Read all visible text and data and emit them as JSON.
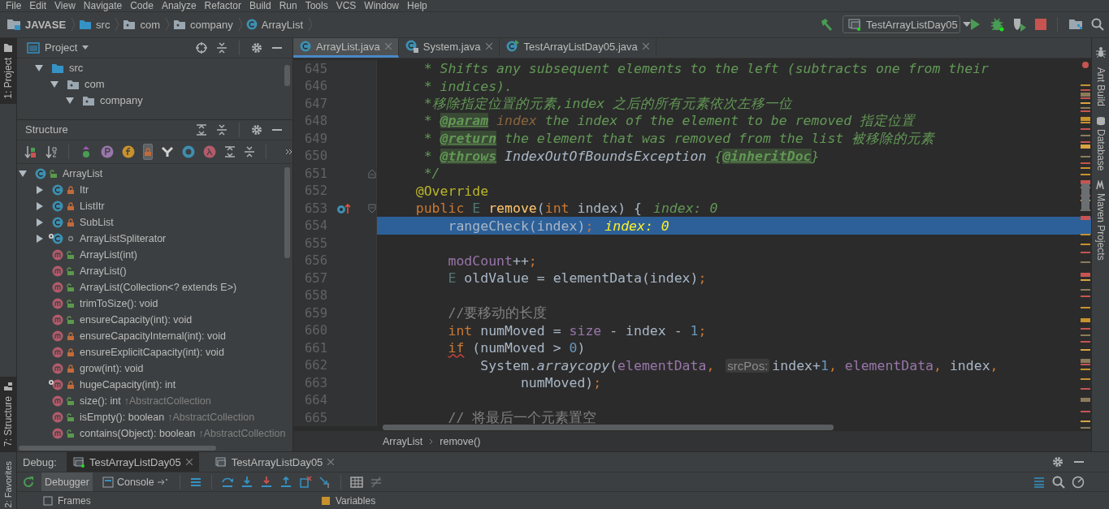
{
  "menu": [
    "File",
    "Edit",
    "View",
    "Navigate",
    "Code",
    "Analyze",
    "Refactor",
    "Build",
    "Run",
    "Tools",
    "VCS",
    "Window",
    "Help"
  ],
  "breadcrumb": [
    {
      "kind": "project",
      "label": "JAVASE"
    },
    {
      "kind": "folder",
      "label": "src"
    },
    {
      "kind": "package",
      "label": "com"
    },
    {
      "kind": "package",
      "label": "company"
    },
    {
      "kind": "class",
      "label": "ArrayList"
    }
  ],
  "run_config": {
    "label": "TestArrayListDay05"
  },
  "left_tool_tabs": [
    {
      "label": "1: Project",
      "selected": true
    },
    {
      "label": "7: Structure",
      "selected": true
    }
  ],
  "favorites_tab": {
    "label": "2: Favorites"
  },
  "project_panel": {
    "title": "Project",
    "tree": [
      {
        "label": "src",
        "kind": "folder",
        "expanded": true,
        "children": [
          {
            "label": "com",
            "kind": "package",
            "expanded": true,
            "children": [
              {
                "label": "company",
                "kind": "package",
                "expanded": true
              }
            ]
          }
        ]
      }
    ]
  },
  "structure_panel": {
    "title": "Structure",
    "tree": [
      {
        "label": "ArrayList",
        "kind": "public-class",
        "static": false,
        "expanded": true,
        "children": [
          {
            "label": "Itr",
            "kind": "private-class",
            "static": false,
            "expanded": false
          },
          {
            "label": "ListItr",
            "kind": "private-class",
            "static": false,
            "expanded": false
          },
          {
            "label": "SubList",
            "kind": "private-class",
            "static": false,
            "expanded": false
          },
          {
            "label": "ArrayListSpliterator",
            "kind": "package-class",
            "static": true,
            "expanded": false
          },
          {
            "label": "ArrayList(int)",
            "kind": "public-method",
            "static": false
          },
          {
            "label": "ArrayList()",
            "kind": "public-method",
            "static": false
          },
          {
            "label": "ArrayList(Collection<? extends E>)",
            "kind": "public-method",
            "static": false
          },
          {
            "label": "trimToSize(): void",
            "kind": "public-method",
            "static": false
          },
          {
            "label": "ensureCapacity(int): void",
            "kind": "public-method",
            "static": false
          },
          {
            "label": "ensureCapacityInternal(int): void",
            "kind": "private-method",
            "static": false
          },
          {
            "label": "ensureExplicitCapacity(int): void",
            "kind": "private-method",
            "static": false
          },
          {
            "label": "grow(int): void",
            "kind": "private-method",
            "static": false
          },
          {
            "label": "hugeCapacity(int): int",
            "kind": "private-method",
            "static": true
          },
          {
            "label": "size(): int",
            "inherited": "↑AbstractCollection",
            "kind": "public-method",
            "static": false
          },
          {
            "label": "isEmpty(): boolean",
            "inherited": "↑AbstractCollection",
            "kind": "public-method",
            "static": false
          },
          {
            "label": "contains(Object): boolean",
            "inherited": "↑AbstractCollection",
            "kind": "public-method",
            "static": false
          }
        ]
      }
    ]
  },
  "editor": {
    "tabs": [
      {
        "label": "ArrayList.java",
        "kind": "class",
        "selected": true
      },
      {
        "label": "System.java",
        "kind": "library-class",
        "selected": false
      },
      {
        "label": "TestArrayListDay05.java",
        "kind": "runnable-class",
        "selected": false
      }
    ],
    "lines": [
      {
        "number": "645",
        "current": false,
        "tokens": [
          {
            "kind": "doc",
            "text": "     * Shifts any subsequent elements to the left (subtracts one from their"
          }
        ]
      },
      {
        "number": "646",
        "current": false,
        "tokens": [
          {
            "kind": "doc",
            "text": "     * indices)."
          }
        ]
      },
      {
        "number": "647",
        "current": false,
        "tokens": [
          {
            "kind": "doc",
            "text": "     *移除指定位置的元素,index 之后的所有元素依次左移一位"
          }
        ]
      },
      {
        "number": "648",
        "current": false,
        "tokens": [
          {
            "kind": "doc",
            "text": "     * "
          },
          {
            "kind": "doctag",
            "text": "@param"
          },
          {
            "kind": "docparam",
            "text": " index"
          },
          {
            "kind": "doc",
            "text": " the index of the element to be removed 指定位置"
          }
        ]
      },
      {
        "number": "649",
        "current": false,
        "tokens": [
          {
            "kind": "doc",
            "text": "     * "
          },
          {
            "kind": "doctag",
            "text": "@return"
          },
          {
            "kind": "doc",
            "text": " the element that was removed from the list 被移除的元素"
          }
        ]
      },
      {
        "number": "650",
        "current": false,
        "tokens": [
          {
            "kind": "doc",
            "text": "     * "
          },
          {
            "kind": "doctag",
            "text": "@throws"
          },
          {
            "kind": "docref",
            "text": " IndexOutOfBoundsException "
          },
          {
            "kind": "doc",
            "text": "{"
          },
          {
            "kind": "doctag",
            "text": "@inheritDoc"
          },
          {
            "kind": "doc",
            "text": "}"
          }
        ]
      },
      {
        "number": "651",
        "current": false,
        "kind": "fold-end",
        "tokens": [
          {
            "kind": "doc",
            "text": "     */"
          }
        ]
      },
      {
        "number": "652",
        "current": false,
        "tokens": [
          {
            "kind": "annotation",
            "text": "    @Override"
          }
        ]
      },
      {
        "number": "653",
        "current": false,
        "kind": "override-method",
        "tokens": [
          {
            "kind": "keyword",
            "text": "    public "
          },
          {
            "kind": "type",
            "text": "E "
          },
          {
            "kind": "method",
            "text": "remove"
          },
          {
            "kind": "plain",
            "text": "("
          },
          {
            "kind": "keyword",
            "text": "int "
          },
          {
            "kind": "plain",
            "text": "index) {"
          },
          {
            "kind": "value-hint",
            "text": "index: 0"
          }
        ]
      },
      {
        "number": "654",
        "current": true,
        "tokens": [
          {
            "kind": "plain",
            "text": "        rangeCheck(index)"
          },
          {
            "kind": "punct",
            "text": ";"
          },
          {
            "kind": "current-hint",
            "text": "index: 0"
          }
        ]
      },
      {
        "number": "655",
        "current": false,
        "kind": "blank"
      },
      {
        "number": "656",
        "current": false,
        "tokens": [
          {
            "kind": "field",
            "text": "        modCount"
          },
          {
            "kind": "plain",
            "text": "++"
          },
          {
            "kind": "punct",
            "text": ";"
          }
        ]
      },
      {
        "number": "657",
        "current": false,
        "tokens": [
          {
            "kind": "type",
            "text": "        E "
          },
          {
            "kind": "plain",
            "text": "oldValue = elementData(index)"
          },
          {
            "kind": "punct",
            "text": ";"
          }
        ]
      },
      {
        "number": "658",
        "current": false,
        "kind": "blank"
      },
      {
        "number": "659",
        "current": false,
        "tokens": [
          {
            "kind": "comment",
            "text": "        //要移动的长度"
          }
        ]
      },
      {
        "number": "660",
        "current": false,
        "tokens": [
          {
            "kind": "keyword",
            "text": "        int "
          },
          {
            "kind": "plain",
            "text": "numMoved = "
          },
          {
            "kind": "field",
            "text": "size"
          },
          {
            "kind": "plain",
            "text": " - index - "
          },
          {
            "kind": "number",
            "text": "1"
          },
          {
            "kind": "punct",
            "text": ";"
          }
        ]
      },
      {
        "number": "661",
        "current": false,
        "tokens": [
          {
            "kind": "keyword-warn",
            "text": "        if"
          },
          {
            "kind": "plain",
            "text": " (numMoved > "
          },
          {
            "kind": "number",
            "text": "0"
          },
          {
            "kind": "plain",
            "text": ")"
          }
        ]
      },
      {
        "number": "662",
        "current": false,
        "tokens": [
          {
            "kind": "plain",
            "text": "            System."
          },
          {
            "kind": "static",
            "text": "arraycopy"
          },
          {
            "kind": "plain",
            "text": "("
          },
          {
            "kind": "field",
            "text": "elementData"
          },
          {
            "kind": "punct",
            "text": ","
          },
          {
            "kind": "param-hint",
            "text": "srcPos:"
          },
          {
            "kind": "plain",
            "text": "index+"
          },
          {
            "kind": "number",
            "text": "1"
          },
          {
            "kind": "punct",
            "text": ", "
          },
          {
            "kind": "field",
            "text": "elementData"
          },
          {
            "kind": "punct",
            "text": ", "
          },
          {
            "kind": "plain",
            "text": "index"
          },
          {
            "kind": "punct",
            "text": ","
          }
        ]
      },
      {
        "number": "663",
        "current": false,
        "tokens": [
          {
            "kind": "plain",
            "text": "                 numMoved)"
          },
          {
            "kind": "punct",
            "text": ";"
          }
        ]
      },
      {
        "number": "664",
        "current": false,
        "kind": "blank"
      },
      {
        "number": "665",
        "current": false,
        "tokens": [
          {
            "kind": "comment",
            "text": "        // 将最后一个元素置空"
          }
        ]
      }
    ],
    "breadcrumb": [
      "ArrayList",
      "remove()"
    ]
  },
  "right_tool_tabs": [
    "Ant Build",
    "Database",
    "Maven Projects"
  ],
  "debug": {
    "title": "Debug:",
    "sessions": [
      {
        "label": "TestArrayListDay05",
        "selected": true
      },
      {
        "label": "TestArrayListDay05",
        "selected": false
      }
    ],
    "tabs": [
      {
        "label": "Debugger",
        "selected": true
      },
      {
        "label": "Console",
        "selected": false
      }
    ],
    "panes": [
      "Frames",
      "Variables"
    ]
  }
}
